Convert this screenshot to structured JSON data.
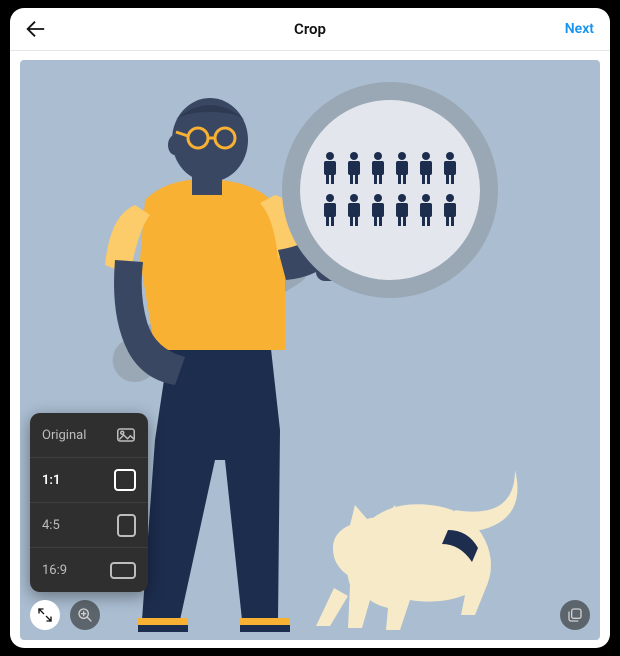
{
  "header": {
    "title": "Crop",
    "next_label": "Next",
    "back_icon": "back-arrow-icon"
  },
  "aspect_popover": {
    "options": [
      {
        "label": "Original",
        "id": "original",
        "selected": false
      },
      {
        "label": "1:1",
        "id": "1_1",
        "selected": true
      },
      {
        "label": "4:5",
        "id": "4_5",
        "selected": false
      },
      {
        "label": "16:9",
        "id": "16_9",
        "selected": false
      }
    ]
  },
  "controls": {
    "expand_icon": "expand-icon",
    "zoom_icon": "zoom-icon",
    "multi_icon": "multi-select-icon"
  },
  "illustration": {
    "description": "Man in orange shirt holding a large magnifying glass showing two rows of small people icons, with a cream-colored cat walking beside him.",
    "colors": {
      "bg": "#aabdd1",
      "skin": "#3a4763",
      "shirt": "#f8b133",
      "pants": "#1d2d4e",
      "lens_rim": "#9aa8b5",
      "lens_fill": "#e3e7ed",
      "people": "#1d2d4e",
      "cat": "#f6eac9",
      "cat_collar": "#1d2d4e"
    }
  }
}
